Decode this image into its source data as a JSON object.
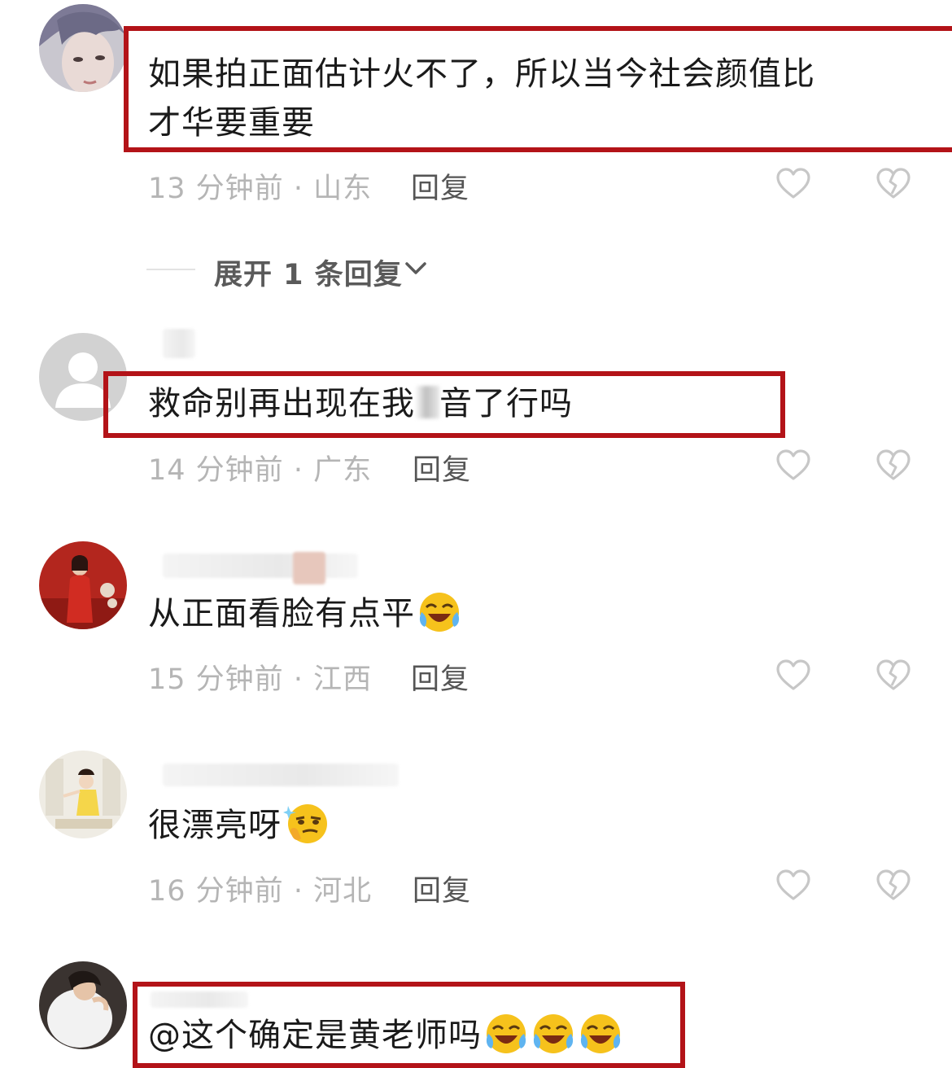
{
  "comments": [
    {
      "text_line1": "如果拍正面估计火不了，所以当今社会颜值比",
      "text_line2": "才华要重要",
      "time": "13 分钟前",
      "region": "山东",
      "reply_label": "回复",
      "expand": {
        "label": "展开 1 条回复"
      },
      "highlighted": true
    },
    {
      "text_before": "救命别再出现在我",
      "text_after": "音了行吗",
      "time": "14 分钟前",
      "region": "广东",
      "reply_label": "回复",
      "highlighted": true
    },
    {
      "text": "从正面看脸有点平",
      "emoji": "laugh-cry-emoji",
      "time": "15 分钟前",
      "region": "江西",
      "reply_label": "回复",
      "highlighted": false
    },
    {
      "text": "很漂亮呀",
      "emoji": "smirk-thinking-emoji",
      "time": "16 分钟前",
      "region": "河北",
      "reply_label": "回复",
      "highlighted": false
    },
    {
      "text": "@这个确定是黄老师吗",
      "emoji": "laugh-cry-emoji",
      "emoji_count": 3,
      "highlighted": true
    }
  ],
  "meta_separator": "·",
  "colors": {
    "highlight_border": "#b31318",
    "meta_text": "#b5b5b5",
    "reply_text": "#555555"
  }
}
